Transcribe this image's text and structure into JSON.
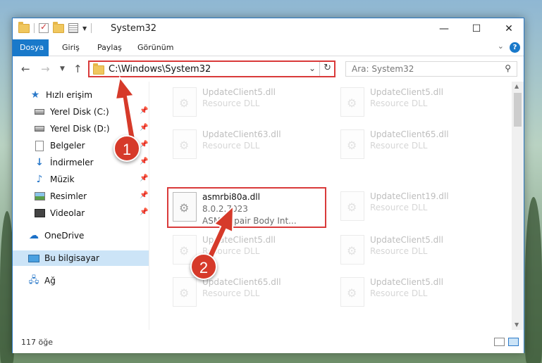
{
  "window": {
    "title": "System32",
    "controls": {
      "minimize": "—",
      "maximize": "☐",
      "close": "✕"
    }
  },
  "ribbon": {
    "tabs": [
      {
        "label": "Dosya",
        "active": true
      },
      {
        "label": "Giriş"
      },
      {
        "label": "Paylaş"
      },
      {
        "label": "Görünüm"
      }
    ],
    "help": "?"
  },
  "address": {
    "path": "C:\\Windows\\System32",
    "search_placeholder": "Ara: System32"
  },
  "sidebar": {
    "items": [
      {
        "label": "Hızlı erişim",
        "icon": "star-icon"
      },
      {
        "label": "Yerel Disk (C:)",
        "icon": "disk-icon",
        "pinned": true
      },
      {
        "label": "Yerel Disk (D:)",
        "icon": "disk-icon",
        "pinned": true
      },
      {
        "label": "Belgeler",
        "icon": "documents-icon",
        "pinned": true
      },
      {
        "label": "İndirmeler",
        "icon": "downloads-icon",
        "pinned": true
      },
      {
        "label": "Müzik",
        "icon": "music-icon",
        "pinned": true
      },
      {
        "label": "Resimler",
        "icon": "pictures-icon",
        "pinned": true
      },
      {
        "label": "Videolar",
        "icon": "videos-icon",
        "pinned": true
      },
      {
        "label": "OneDrive",
        "icon": "cloud-icon"
      },
      {
        "label": "Bu bilgisayar",
        "icon": "computer-icon",
        "selected": true
      },
      {
        "label": "Ağ",
        "icon": "network-icon"
      }
    ]
  },
  "files": [
    {
      "name": "UpdateClient5.dll",
      "type": "Resource DLL",
      "faded": true
    },
    {
      "name": "UpdateClient5.dll",
      "type": "Resource DLL",
      "faded": true
    },
    {
      "name": "UpdateClient63.dll",
      "type": "Resource DLL",
      "faded": true
    },
    {
      "name": "UpdateClient65.dll",
      "type": "Resource DLL",
      "faded": true
    },
    {
      "name": "asmrbi80a.dll",
      "version": "8.0.2.7023",
      "description": "ASM Repair Body Int...",
      "faded": false
    },
    {
      "name": "UpdateClient19.dll",
      "type": "Resource DLL",
      "faded": true
    },
    {
      "name": "UpdateClient5.dll",
      "type": "Resource DLL",
      "faded": true
    },
    {
      "name": "UpdateClient5.dll",
      "type": "Resource DLL",
      "faded": true
    },
    {
      "name": "UpdateClient65.dll",
      "type": "Resource DLL",
      "faded": true
    },
    {
      "name": "UpdateClient5.dll",
      "type": "Resource DLL",
      "faded": true
    }
  ],
  "status": {
    "item_count": "117 öğe"
  },
  "annotations": {
    "step1": "1",
    "step2": "2",
    "color": "#d63a2a"
  }
}
